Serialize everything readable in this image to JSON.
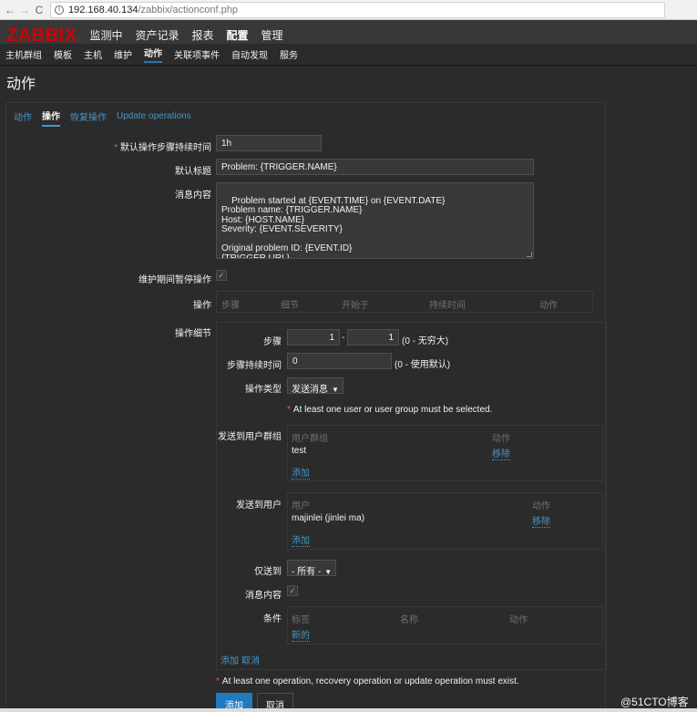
{
  "browser": {
    "back": "←",
    "forward": "→",
    "reload": "C",
    "info": "i",
    "url_host": "192.168.40.134",
    "url_path": "/zabbix/actionconf.php"
  },
  "topmenu": {
    "logo": "ZABBIX",
    "items": [
      "监测中",
      "资产记录",
      "报表",
      "配置",
      "管理"
    ]
  },
  "submenu": {
    "items": [
      "主机群组",
      "模板",
      "主机",
      "维护",
      "动作",
      "关联项事件",
      "自动发现",
      "服务"
    ]
  },
  "page": {
    "title": "动作"
  },
  "tabs": [
    "动作",
    "操作",
    "恢复操作",
    "Update operations"
  ],
  "form": {
    "step_duration_label": "默认操作步骤持续时间",
    "step_duration_value": "1h",
    "default_subject_label": "默认标题",
    "default_subject_value": "Problem: {TRIGGER.NAME}",
    "message_label": "消息内容",
    "message_value": "Problem started at {EVENT.TIME} on {EVENT.DATE}\nProblem name: {TRIGGER.NAME}\nHost: {HOST.NAME}\nSeverity: {EVENT.SEVERITY}\n\nOriginal problem ID: {EVENT.ID}\n{TRIGGER.URL}",
    "pause_label": "维护期间暂停操作",
    "operations_label": "操作",
    "operations_columns": [
      "步骤",
      "细节",
      "开始于",
      "持续时间",
      "动作"
    ],
    "details_label": "操作细节"
  },
  "details": {
    "steps_label": "步骤",
    "step_from": "1",
    "step_separator": "-",
    "step_to": "1",
    "step_hint": "(0 - 无穷大)",
    "step_duration_label": "步骤持续时间",
    "step_duration_value": "0",
    "step_duration_hint": "(0 - 使用默认)",
    "op_type_label": "操作类型",
    "op_type_value": "发送消息",
    "user_warning": "At least one user or user group must be selected.",
    "groups_label": "发送到用户群组",
    "groups_col_group": "用户群组",
    "groups_col_action": "动作",
    "group_name": "test",
    "group_remove": "移除",
    "group_add": "添加",
    "users_label": "发送到用户",
    "users_col_user": "用户",
    "users_col_action": "动作",
    "user_name": "majinlei (jinlei ma)",
    "user_remove": "移除",
    "user_add": "添加",
    "send_only_label": "仅送到",
    "send_only_value": "- 所有 -",
    "msg_content_label": "消息内容",
    "conditions_label": "条件",
    "cond_col_label": "标签",
    "cond_col_name": "名称",
    "cond_col_action": "动作",
    "cond_new": "新的",
    "detail_add": "添加",
    "detail_cancel": "取消"
  },
  "footer": {
    "op_warning": "At least one operation, recovery operation or update operation must exist.",
    "add_button": "添加",
    "cancel_button": "取消"
  },
  "watermark": "@51CTO博客"
}
